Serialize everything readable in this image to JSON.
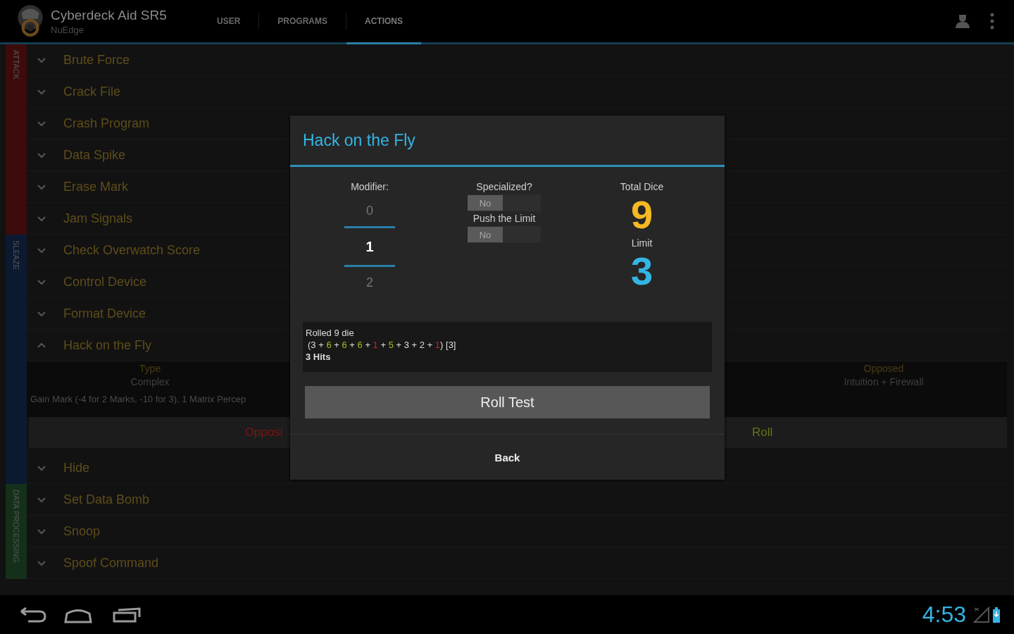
{
  "app_bar": {
    "title": "Cyberdeck Aid SR5",
    "subtitle": "NuEdge",
    "tabs": [
      {
        "label": "USER",
        "selected": false
      },
      {
        "label": "PROGRAMS",
        "selected": false
      },
      {
        "label": "ACTIONS",
        "selected": true
      }
    ]
  },
  "categories": [
    {
      "label": "ATTACK",
      "color": "#3d0b0b",
      "actions": [
        {
          "name": "Brute Force",
          "expanded": false
        },
        {
          "name": "Crack File",
          "expanded": false
        },
        {
          "name": "Crash Program",
          "expanded": false
        },
        {
          "name": "Data Spike",
          "expanded": false
        },
        {
          "name": "Erase Mark",
          "expanded": false
        },
        {
          "name": "Jam Signals",
          "expanded": false
        }
      ]
    },
    {
      "label": "SLEAZE",
      "color": "#0b1a30",
      "actions": [
        {
          "name": "Check Overwatch Score",
          "expanded": false
        },
        {
          "name": "Control Device",
          "expanded": false
        },
        {
          "name": "Format Device",
          "expanded": false
        },
        {
          "name": "Hack on the Fly",
          "expanded": true,
          "details": {
            "type_label": "Type",
            "type_value": "Complex",
            "opposed_label": "Opposed",
            "opposed_value": "Intuition + Firewall",
            "description": "Gain Mark (-4 for 2 Marks, -10 for 3), 1 Matrix Percep",
            "buttons": [
              {
                "label": "Opposi",
                "kind": "opposed"
              },
              {
                "label": "Roll",
                "kind": "roll"
              }
            ]
          }
        },
        {
          "name": "Hide",
          "expanded": false
        }
      ]
    },
    {
      "label": "DATA PROCESSING",
      "color": "#14301a",
      "actions": [
        {
          "name": "Set Data Bomb",
          "expanded": false
        },
        {
          "name": "Snoop",
          "expanded": false
        },
        {
          "name": "Spoof Command",
          "expanded": false
        }
      ]
    }
  ],
  "dialog": {
    "title": "Hack on the Fly",
    "modifier": {
      "label": "Modifier:",
      "values": [
        {
          "value": "0",
          "selected": false
        },
        {
          "value": "1",
          "selected": true
        },
        {
          "value": "2",
          "selected": false
        }
      ]
    },
    "toggles": [
      {
        "label": "Specialized?",
        "state": "No",
        "on": false
      },
      {
        "label": "Push the Limit",
        "state": "No",
        "on": false
      }
    ],
    "total_dice": {
      "label": "Total Dice",
      "value": "9"
    },
    "limit": {
      "label": "Limit",
      "value": "3"
    },
    "result": {
      "header": "Rolled 9 die",
      "open": "(",
      "separator": "+",
      "close": ")",
      "dice": [
        {
          "value": "3",
          "kind": "miss"
        },
        {
          "value": "6",
          "kind": "hit"
        },
        {
          "value": "6",
          "kind": "hit"
        },
        {
          "value": "6",
          "kind": "hit"
        },
        {
          "value": "1",
          "kind": "glitch"
        },
        {
          "value": "5",
          "kind": "hit"
        },
        {
          "value": "3",
          "kind": "miss"
        },
        {
          "value": "2",
          "kind": "miss"
        },
        {
          "value": "1",
          "kind": "glitch"
        }
      ],
      "limit_note": "[3]",
      "hits": "3 Hits"
    },
    "roll_button": "Roll Test",
    "back_button": "Back"
  },
  "status_bar": {
    "time": "4:53"
  }
}
